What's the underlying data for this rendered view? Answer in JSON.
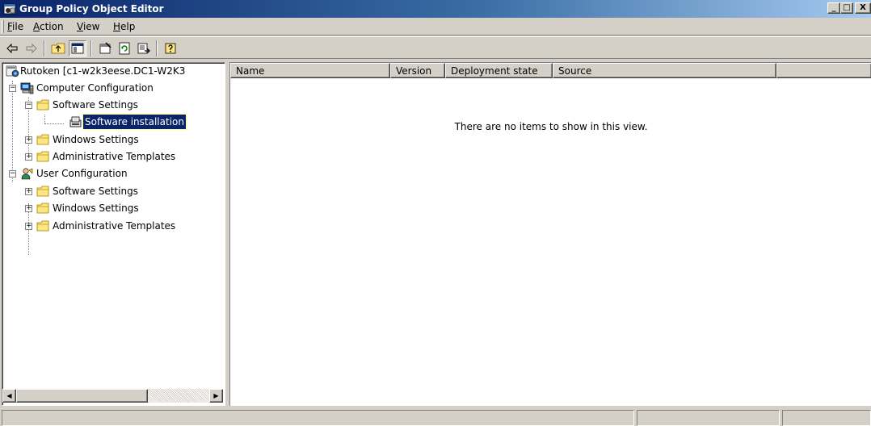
{
  "window": {
    "title": "Group Policy Object Editor",
    "controls": {
      "minimize": "_",
      "maximize": "□",
      "close": "X"
    }
  },
  "menubar": {
    "items": [
      {
        "label": "File",
        "accel": "F",
        "rest": "ile"
      },
      {
        "label": "Action",
        "accel": "A",
        "rest": "ction"
      },
      {
        "label": "View",
        "accel": "V",
        "rest": "iew"
      },
      {
        "label": "Help",
        "accel": "H",
        "rest": "elp"
      }
    ]
  },
  "toolbar": {
    "buttons": [
      {
        "name": "back-icon"
      },
      {
        "name": "forward-icon"
      },
      {
        "name": "up-one-level-icon"
      },
      {
        "name": "show-hide-console-tree-icon",
        "pressed": true
      },
      {
        "name": "properties-icon"
      },
      {
        "name": "refresh-icon"
      },
      {
        "name": "export-list-icon"
      },
      {
        "name": "help-icon"
      }
    ]
  },
  "tree": {
    "root": "Rutoken [c1-w2k3eese.DC1-W2K3",
    "computer_config": "Computer Configuration",
    "cc_software_settings": "Software Settings",
    "cc_software_installation": "Software installation",
    "cc_windows_settings": "Windows Settings",
    "cc_admin_templates": "Administrative Templates",
    "user_config": "User Configuration",
    "uc_software_settings": "Software Settings",
    "uc_windows_settings": "Windows Settings",
    "uc_admin_templates": "Administrative Templates"
  },
  "list": {
    "columns": [
      "Name",
      "Version",
      "Deployment state",
      "Source"
    ],
    "empty_message": "There are no items to show in this view."
  },
  "colors": {
    "selection": "#0a246a",
    "titlebar_start": "#0a246a",
    "titlebar_end": "#a6caf0",
    "face": "#d4d0c8"
  }
}
